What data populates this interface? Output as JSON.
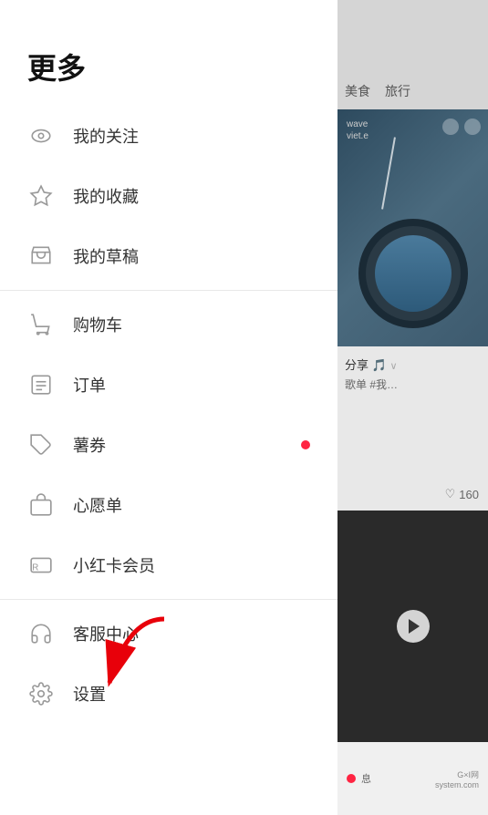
{
  "page": {
    "title": "更多"
  },
  "menu": {
    "items": [
      {
        "id": "follow",
        "label": "我的关注",
        "icon": "eye"
      },
      {
        "id": "collection",
        "label": "我的收藏",
        "icon": "star"
      },
      {
        "id": "draft",
        "label": "我的草稿",
        "icon": "inbox"
      },
      {
        "id": "cart",
        "label": "购物车",
        "icon": "cart"
      },
      {
        "id": "order",
        "label": "订单",
        "icon": "list"
      },
      {
        "id": "coupon",
        "label": "薯券",
        "icon": "tag",
        "hasDot": true
      },
      {
        "id": "wishlist",
        "label": "心愿单",
        "icon": "bag"
      },
      {
        "id": "membership",
        "label": "小红卡会员",
        "icon": "card"
      },
      {
        "id": "service",
        "label": "客服中心",
        "icon": "headset"
      },
      {
        "id": "settings",
        "label": "设置",
        "icon": "gear"
      }
    ]
  },
  "right_panel": {
    "tags": [
      "美食",
      "旅行"
    ],
    "card1": {
      "label": "wave\nviet.e"
    },
    "card2": {
      "share_prefix": "分享",
      "subtitle": "歌单 #我…",
      "like_count": "160"
    },
    "bottom": {
      "text": "息"
    }
  },
  "watermark": "G×I网\nsystem.com"
}
